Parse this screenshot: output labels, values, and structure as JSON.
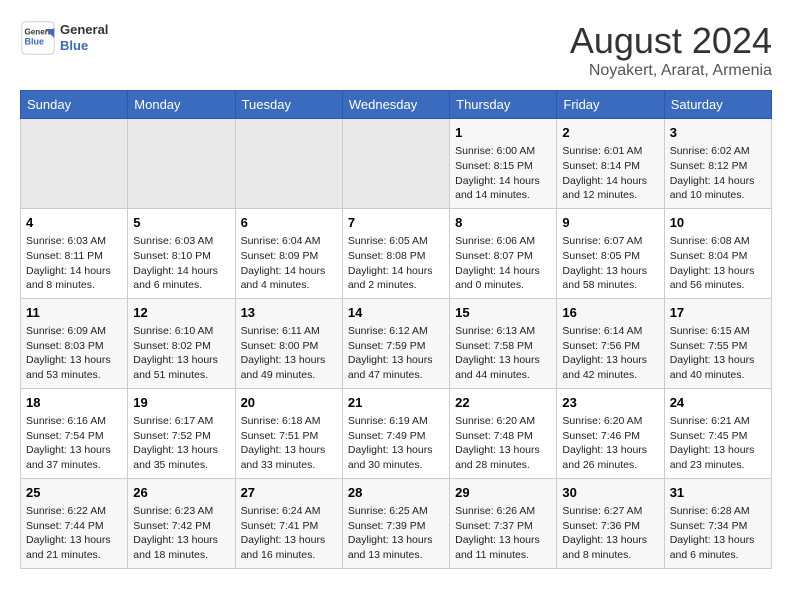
{
  "header": {
    "logo_line1": "General",
    "logo_line2": "Blue",
    "title": "August 2024",
    "subtitle": "Noyakert, Ararat, Armenia"
  },
  "days_of_week": [
    "Sunday",
    "Monday",
    "Tuesday",
    "Wednesday",
    "Thursday",
    "Friday",
    "Saturday"
  ],
  "weeks": [
    [
      {
        "day": "",
        "content": ""
      },
      {
        "day": "",
        "content": ""
      },
      {
        "day": "",
        "content": ""
      },
      {
        "day": "",
        "content": ""
      },
      {
        "day": "1",
        "content": "Sunrise: 6:00 AM\nSunset: 8:15 PM\nDaylight: 14 hours\nand 14 minutes."
      },
      {
        "day": "2",
        "content": "Sunrise: 6:01 AM\nSunset: 8:14 PM\nDaylight: 14 hours\nand 12 minutes."
      },
      {
        "day": "3",
        "content": "Sunrise: 6:02 AM\nSunset: 8:12 PM\nDaylight: 14 hours\nand 10 minutes."
      }
    ],
    [
      {
        "day": "4",
        "content": "Sunrise: 6:03 AM\nSunset: 8:11 PM\nDaylight: 14 hours\nand 8 minutes."
      },
      {
        "day": "5",
        "content": "Sunrise: 6:03 AM\nSunset: 8:10 PM\nDaylight: 14 hours\nand 6 minutes."
      },
      {
        "day": "6",
        "content": "Sunrise: 6:04 AM\nSunset: 8:09 PM\nDaylight: 14 hours\nand 4 minutes."
      },
      {
        "day": "7",
        "content": "Sunrise: 6:05 AM\nSunset: 8:08 PM\nDaylight: 14 hours\nand 2 minutes."
      },
      {
        "day": "8",
        "content": "Sunrise: 6:06 AM\nSunset: 8:07 PM\nDaylight: 14 hours\nand 0 minutes."
      },
      {
        "day": "9",
        "content": "Sunrise: 6:07 AM\nSunset: 8:05 PM\nDaylight: 13 hours\nand 58 minutes."
      },
      {
        "day": "10",
        "content": "Sunrise: 6:08 AM\nSunset: 8:04 PM\nDaylight: 13 hours\nand 56 minutes."
      }
    ],
    [
      {
        "day": "11",
        "content": "Sunrise: 6:09 AM\nSunset: 8:03 PM\nDaylight: 13 hours\nand 53 minutes."
      },
      {
        "day": "12",
        "content": "Sunrise: 6:10 AM\nSunset: 8:02 PM\nDaylight: 13 hours\nand 51 minutes."
      },
      {
        "day": "13",
        "content": "Sunrise: 6:11 AM\nSunset: 8:00 PM\nDaylight: 13 hours\nand 49 minutes."
      },
      {
        "day": "14",
        "content": "Sunrise: 6:12 AM\nSunset: 7:59 PM\nDaylight: 13 hours\nand 47 minutes."
      },
      {
        "day": "15",
        "content": "Sunrise: 6:13 AM\nSunset: 7:58 PM\nDaylight: 13 hours\nand 44 minutes."
      },
      {
        "day": "16",
        "content": "Sunrise: 6:14 AM\nSunset: 7:56 PM\nDaylight: 13 hours\nand 42 minutes."
      },
      {
        "day": "17",
        "content": "Sunrise: 6:15 AM\nSunset: 7:55 PM\nDaylight: 13 hours\nand 40 minutes."
      }
    ],
    [
      {
        "day": "18",
        "content": "Sunrise: 6:16 AM\nSunset: 7:54 PM\nDaylight: 13 hours\nand 37 minutes."
      },
      {
        "day": "19",
        "content": "Sunrise: 6:17 AM\nSunset: 7:52 PM\nDaylight: 13 hours\nand 35 minutes."
      },
      {
        "day": "20",
        "content": "Sunrise: 6:18 AM\nSunset: 7:51 PM\nDaylight: 13 hours\nand 33 minutes."
      },
      {
        "day": "21",
        "content": "Sunrise: 6:19 AM\nSunset: 7:49 PM\nDaylight: 13 hours\nand 30 minutes."
      },
      {
        "day": "22",
        "content": "Sunrise: 6:20 AM\nSunset: 7:48 PM\nDaylight: 13 hours\nand 28 minutes."
      },
      {
        "day": "23",
        "content": "Sunrise: 6:20 AM\nSunset: 7:46 PM\nDaylight: 13 hours\nand 26 minutes."
      },
      {
        "day": "24",
        "content": "Sunrise: 6:21 AM\nSunset: 7:45 PM\nDaylight: 13 hours\nand 23 minutes."
      }
    ],
    [
      {
        "day": "25",
        "content": "Sunrise: 6:22 AM\nSunset: 7:44 PM\nDaylight: 13 hours\nand 21 minutes."
      },
      {
        "day": "26",
        "content": "Sunrise: 6:23 AM\nSunset: 7:42 PM\nDaylight: 13 hours\nand 18 minutes."
      },
      {
        "day": "27",
        "content": "Sunrise: 6:24 AM\nSunset: 7:41 PM\nDaylight: 13 hours\nand 16 minutes."
      },
      {
        "day": "28",
        "content": "Sunrise: 6:25 AM\nSunset: 7:39 PM\nDaylight: 13 hours\nand 13 minutes."
      },
      {
        "day": "29",
        "content": "Sunrise: 6:26 AM\nSunset: 7:37 PM\nDaylight: 13 hours\nand 11 minutes."
      },
      {
        "day": "30",
        "content": "Sunrise: 6:27 AM\nSunset: 7:36 PM\nDaylight: 13 hours\nand 8 minutes."
      },
      {
        "day": "31",
        "content": "Sunrise: 6:28 AM\nSunset: 7:34 PM\nDaylight: 13 hours\nand 6 minutes."
      }
    ]
  ]
}
